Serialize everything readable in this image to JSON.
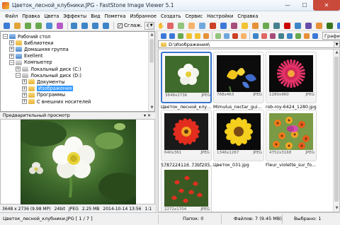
{
  "window": {
    "title": "Цветок_лесной_клубники.JPG - FastStone Image Viewer 5.1",
    "min_glyph": "—",
    "max_glyph": "☐",
    "close_glyph": "✕"
  },
  "menu": [
    "Файл",
    "Правка",
    "Цвета",
    "Эффекты",
    "Вид",
    "Пометка",
    "Избранное",
    "Создать",
    "Сервис",
    "Настройки",
    "Справка"
  ],
  "toolbar": {
    "smooth_label": "Сглаж.",
    "smooth_checked": "✓",
    "zoom_value": "8%",
    "view_mode": "Графика",
    "hand_glyph": "✋"
  },
  "icon_colors": {
    "tb1": [
      "#3a7bd5",
      "#e0a33a",
      "#6aa84f",
      "#6aa84f",
      "#4c8fd6",
      "#b55ac7",
      "#3d85c6",
      "#3d85c6",
      "#3d85c6",
      "#3d85c6",
      "#e06666",
      "#93c47d",
      "#f6b26b",
      "#6fa8dc",
      "#cc4125",
      "#3c78d8",
      "#a64d79",
      "#f1c232",
      "#e69138",
      "#6aa84f",
      "#45818e",
      "#cc0000",
      "#3d85c6",
      "#674ea7",
      "#e69138",
      "#38761d",
      "#3c78d8",
      "#0b5394",
      "#f1c232",
      "#e06666",
      "#3d85c6",
      "#6aa84f"
    ],
    "tb2": [
      "#3c78d8",
      "#3c78d8",
      "#6aa84f",
      "#f1c232",
      "#f1c232",
      "#e69138",
      "#93c47d",
      "#6fa8dc",
      "#cc4125",
      "#f6b26b",
      "#3d85c6",
      "#e06666",
      "#a64d79",
      "#45818e",
      "#3d85c6",
      "#6aa84f",
      "#e69138",
      "#3c78d8",
      "#674ea7",
      "#0b5394",
      "#38761d",
      "#cc0000"
    ]
  },
  "tree": [
    {
      "label": "Рабочий стол",
      "indent": 0,
      "icon": "blue",
      "exp": "−"
    },
    {
      "label": "Библиотеки",
      "indent": 1,
      "icon": "yellow",
      "exp": "+"
    },
    {
      "label": "Домашняя группа",
      "indent": 1,
      "icon": "blue",
      "exp": "+"
    },
    {
      "label": "Exellent",
      "indent": 1,
      "icon": "blue",
      "exp": "+"
    },
    {
      "label": "Компьютер",
      "indent": 1,
      "icon": "drive",
      "exp": "−"
    },
    {
      "label": "Локальный диск (C:)",
      "indent": 2,
      "icon": "drive",
      "exp": "+"
    },
    {
      "label": "Локальный диск (D:)",
      "indent": 2,
      "icon": "drive",
      "exp": "−"
    },
    {
      "label": "Документы",
      "indent": 3,
      "icon": "yellow",
      "exp": "+"
    },
    {
      "label": "Изображения",
      "indent": 3,
      "icon": "yellow",
      "exp": "+",
      "selected": true
    },
    {
      "label": "Программы",
      "indent": 3,
      "icon": "yellow",
      "exp": "+"
    },
    {
      "label": "С внешних носителей",
      "indent": 3,
      "icon": "yellow",
      "exp": "+"
    }
  ],
  "preview": {
    "header": "Предварительный просмотр",
    "pin": "▾ ✕",
    "status": [
      "3648 x 2736 (9.98 MP)",
      "24bit",
      "JPEG",
      "2.25 MB",
      "2014-10-14 13:56",
      "1:1"
    ]
  },
  "path": "D:\\Изображения\\",
  "thumbnails": [
    {
      "caption": "Цветок_лесной_клу...",
      "dims": "3648x2736",
      "format": "JPEG",
      "kind": "white",
      "selected": true
    },
    {
      "caption": "Mimulus_nectar_gui...",
      "dims": "768x463",
      "format": "JPEG",
      "kind": "yellowblue"
    },
    {
      "caption": "rob-roy-6424_1280.jpg",
      "dims": "1280x960",
      "format": "JPEG",
      "kind": "pink"
    },
    {
      "caption": "5787224116_73bf205...",
      "dims": "640x361",
      "format": "JPEG",
      "kind": "red"
    },
    {
      "caption": "Цветок_031.jpg",
      "dims": "1346x1267",
      "format": "JPEG",
      "kind": "yellow"
    },
    {
      "caption": "Fleur_violette_sur_fo...",
      "dims": "4752x3168",
      "format": "JPEG",
      "kind": "orange"
    },
    {
      "caption": "",
      "dims": "2272x1704",
      "format": "JPEG",
      "kind": "redcluster"
    }
  ],
  "status": {
    "file": "Цветок_лесной_клубники.JPG [ 1 / 7 ]",
    "folders": "Папок: 0",
    "files": "Файлов: 7 (9.45 MB)",
    "selected": "Выбрано: 1"
  }
}
